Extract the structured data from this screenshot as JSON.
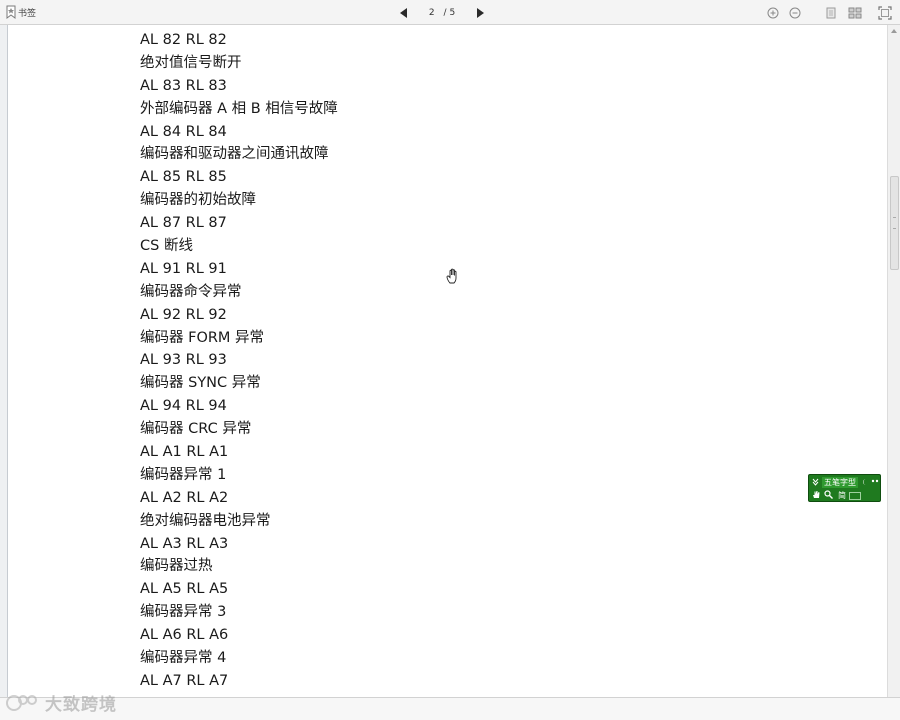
{
  "toolbar": {
    "bookmark_label": "书签",
    "page_current": "2",
    "page_total": "/ 5",
    "icons": [
      "bookmark-icon",
      "prev-page-icon",
      "next-page-icon",
      "zoom-in-icon",
      "zoom-out-icon",
      "single-page-icon",
      "multi-page-icon",
      "fullscreen-icon"
    ]
  },
  "document": {
    "lines": [
      "AL 82 RL 82",
      "绝对值信号断开",
      "AL 83 RL 83",
      "外部编码器 A 相 B 相信号故障",
      "AL 84 RL 84",
      "编码器和驱动器之间通讯故障",
      "AL 85 RL 85",
      "编码器的初始故障",
      "AL 87 RL 87",
      "CS 断线",
      "AL 91 RL 91",
      "编码器命令异常",
      "AL 92 RL 92",
      "编码器 FORM 异常",
      "AL 93 RL 93",
      "编码器 SYNC 异常",
      "AL 94 RL 94",
      "编码器 CRC 异常",
      "AL A1 RL A1",
      "编码器异常 1",
      "AL A2 RL A2",
      "绝对编码器电池异常",
      "AL A3 RL A3",
      "编码器过热",
      "AL A5 RL A5",
      "编码器异常 3",
      "AL A6 RL A6",
      "编码器异常 4",
      "AL A7 RL A7"
    ]
  },
  "ime": {
    "name": "五笔字型",
    "mode": "简",
    "icons": [
      "ime-logo-icon",
      "moon-icon",
      "punctuation-icon",
      "hand-icon",
      "search-icon",
      "keyboard-icon"
    ]
  },
  "watermark": {
    "text": "大致跨境"
  },
  "colors": {
    "ime_green": "#1f7a1f",
    "toolbar_bg": "#f4f4f4",
    "nav_arrow": "#2a2a2a",
    "text": "#1a1a1a"
  }
}
